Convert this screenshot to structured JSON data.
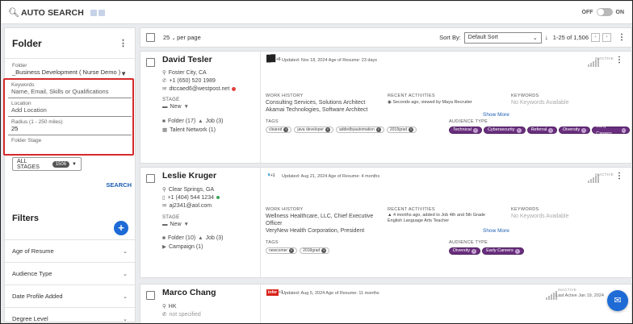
{
  "topbar": {
    "title": "AUTO SEARCH",
    "toggle_off": "OFF",
    "toggle_on": "ON"
  },
  "sidebar": {
    "folder_heading": "Folder",
    "folder_label": "Folder",
    "folder_value": "_Business Development ( Nurse Demo )",
    "keywords_label": "Keywords",
    "keywords_placeholder": "Name, Email, Skills or Qualifications",
    "location_label": "Location",
    "location_placeholder": "Add Location",
    "radius_label": "Radius (1 - 250 miles)",
    "radius_value": "25",
    "stage_label": "Folder Stage",
    "stage_button": "ALL STAGES",
    "stage_count": "1506",
    "search_button": "SEARCH",
    "filters_heading": "Filters",
    "filters": [
      "Age of Resume",
      "Audience Type",
      "Date Profile Added",
      "Degree Level"
    ]
  },
  "toolbar": {
    "per_page_value": "25",
    "per_page_label": "per page",
    "sort_label": "Sort By:",
    "sort_value": "Default Sort",
    "range": "1-25 of 1,506"
  },
  "cards": [
    {
      "name": "David Tesler",
      "location": "Foster City, CA",
      "phone": "+1 (650) 520 1989",
      "email": "dtccaed6@westpost.net",
      "stage_label": "STAGE",
      "stage_value": "New",
      "folder": "Folder (17)",
      "job": "Job (3)",
      "extra": "Talent Network (1)",
      "logo_extra": "+6",
      "updated": "Updated: Nov 18, 2024 Age of Resume: 23 days",
      "work_history_label": "WORK HISTORY",
      "work_history": [
        "Consulting Services, Solutions Architect",
        "Akamai Technologies, Software Architect"
      ],
      "recent_label": "RECENT ACTIVITIES",
      "recent": "Seconds ago, viewed by Maya Recruiter",
      "show_more": "Show More",
      "keywords_label": "KEYWORDS",
      "keywords_value": "No Keywords Available",
      "tags_label": "TAGS",
      "tags": [
        "cleared",
        "java developer",
        "addedbyautomation",
        "2018grad"
      ],
      "audience_label": "AUDIENCE TYPE",
      "audience": [
        "Technical",
        "Cybersecurity",
        "Referral",
        "Diversity",
        "Early Careers"
      ],
      "status": "INACTIVE"
    },
    {
      "name": "Leslie Kruger",
      "location": "Clear Springs, GA",
      "phone": "+1 (404) 544 1234",
      "email": "aj2341@aol.com",
      "stage_label": "STAGE",
      "stage_value": "New",
      "folder": "Folder (10)",
      "job": "Job (3)",
      "extra": "Campaign (1)",
      "logo_extra": "+1",
      "updated": "Updated: Aug 21, 2024 Age of Resume: 4 months",
      "work_history_label": "WORK HISTORY",
      "work_history": [
        "Wellness Healthcare, LLC, Chief Executive",
        "Officer",
        "VeryNew Health Corporation, President"
      ],
      "recent_label": "RECENT ACTIVITIES",
      "recent": "4 months ago, added to Job 4th and 5th Grade English Language Arts Teacher",
      "show_more": "Show More",
      "keywords_label": "KEYWORDS",
      "keywords_value": "No Keywords Available",
      "tags_label": "TAGS",
      "tags": [
        "newcomer",
        "2018grad"
      ],
      "audience_label": "AUDIENCE TYPE",
      "audience": [
        "Diversity",
        "Early Careers"
      ],
      "status": "INACTIVE"
    },
    {
      "name": "Marco Chang",
      "location": "HK",
      "phone": "not specified",
      "logo_extra": "+1",
      "updated": "Updated: Aug 5, 2024 Age of Resume: 11 months",
      "status": "INACTIVE",
      "last_active": "Last Active Jan 19, 2024"
    }
  ]
}
